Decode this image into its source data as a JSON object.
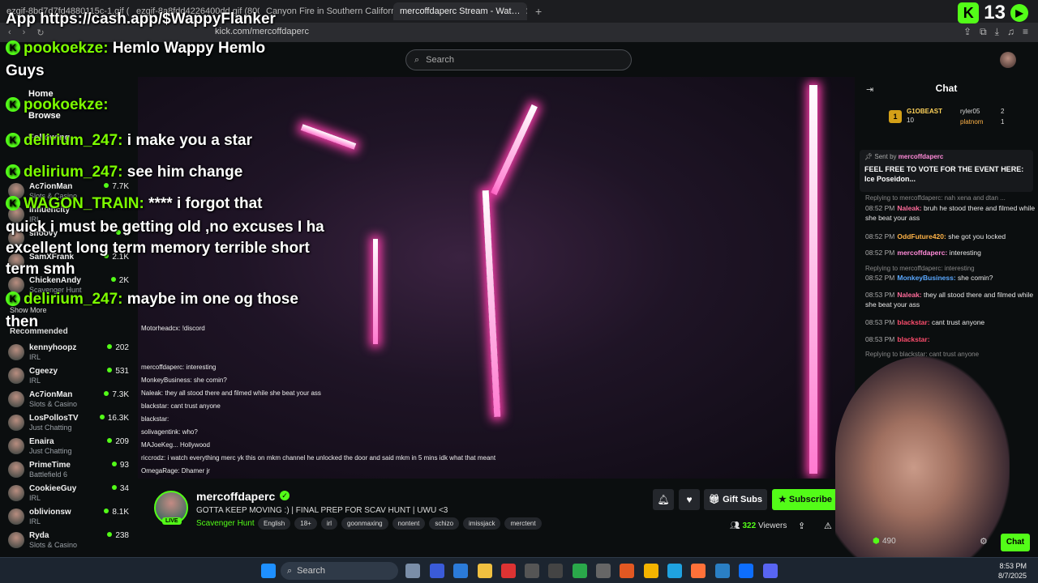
{
  "browser": {
    "tabs": [
      {
        "label": "ezgif-8bd7d7fd4880115c-1.gif (800×4…"
      },
      {
        "label": "ezgif-8a8fdd4226400dd.gif (800×4…"
      },
      {
        "label": "Canyon Fire in Southern California - …"
      },
      {
        "label": "mercoffdaperc Stream - Wat…"
      }
    ],
    "url": "kick.com/mercoffdaperc"
  },
  "search": {
    "placeholder": "Search"
  },
  "stream_overlay": {
    "line1": "App https://cash.app/$WappyFlanker",
    "messages": [
      {
        "user": "pookoekze:",
        "text": "Hemlo Wappy Hemlo"
      },
      {
        "text": "Guys"
      },
      {
        "user": "pookoekze:",
        "text": ""
      },
      {
        "user": "delirium_247:",
        "text": "i make you a star"
      },
      {
        "user": "delirium_247:",
        "text": "see him change"
      },
      {
        "user": "WAGON_TRAIN:",
        "text": "**** i forgot that"
      },
      {
        "text": "quick i must be getting old ,no excuses I ha"
      },
      {
        "text": "excellent long term memory terrible short"
      },
      {
        "text": "term smh"
      },
      {
        "user": "delirium_247:",
        "text": "maybe im one og those"
      },
      {
        "text": "then"
      }
    ],
    "score": "13"
  },
  "sidebar": {
    "nav": [
      {
        "label": "Home"
      },
      {
        "label": "Browse"
      },
      {
        "label": "Following"
      }
    ],
    "following": [
      {
        "name": "Ac7ionMan",
        "category": "Slots & Casino",
        "viewers": "7.7K"
      },
      {
        "name": "Influencity",
        "category": "IRL",
        "viewers": ""
      },
      {
        "name": "snoovy",
        "category": "",
        "viewers": "2"
      },
      {
        "name": "SamXFrank",
        "category": "",
        "viewers": "2.1K"
      },
      {
        "name": "ChickenAndy",
        "category": "Scavenger Hunt",
        "viewers": "2K"
      }
    ],
    "show_more": "Show More",
    "recommended_label": "Recommended",
    "recommended": [
      {
        "name": "kennyhoopz",
        "category": "IRL",
        "viewers": "202"
      },
      {
        "name": "Cgeezy",
        "category": "IRL",
        "viewers": "531"
      },
      {
        "name": "Ac7ionMan",
        "category": "Slots & Casino",
        "viewers": "7.3K"
      },
      {
        "name": "LosPollosTV",
        "category": "Just Chatting",
        "viewers": "16.3K"
      },
      {
        "name": "Enaira",
        "category": "Just Chatting",
        "viewers": "209"
      },
      {
        "name": "PrimeTime",
        "category": "Battlefield 6",
        "viewers": "93"
      },
      {
        "name": "CookieeGuy",
        "category": "IRL",
        "viewers": "34"
      },
      {
        "name": "oblivionsw",
        "category": "IRL",
        "viewers": "8.1K"
      },
      {
        "name": "Ryda",
        "category": "Slots & Casino",
        "viewers": "238"
      }
    ]
  },
  "video_chat": {
    "top": "Motorheadcx: !discord",
    "lines": [
      "mercoffdaperc: interesting",
      "MonkeyBusiness: she comin?",
      "Naleak: they all stood there and filmed while she beat your ass",
      "blackstar: cant trust anyone",
      "blackstar:",
      "solivagentink: who?",
      "MAJoeKeg... Hollywood",
      "riccrodz: i watch everything merc yk this on mkm channel he unlocked the door and said mkm in 5 mins idk what that meant",
      "OmegaRage: Dhamer jr"
    ]
  },
  "channel": {
    "name": "mercoffdaperc",
    "live": "LIVE",
    "title": "GOTTA KEEP MOVING :) | FINAL PREP FOR SCAV HUNT | UWU <3",
    "category": "Scavenger Hunt",
    "tags": [
      "English",
      "18+",
      "irl",
      "goonmaxing",
      "nontent",
      "schizo",
      "imissjack",
      "merctent"
    ],
    "gift_label": "Gift Subs",
    "subscribe_label": "Subscribe",
    "viewers": "322",
    "viewers_label": "Viewers"
  },
  "chat": {
    "title": "Chat",
    "leaderboard": [
      {
        "name": "G1OBEAST",
        "value": "10"
      },
      {
        "name": "ryler05",
        "value": "2"
      },
      {
        "name": "platnom",
        "value": "1"
      }
    ],
    "pinned": {
      "sender_prefix": "Sent by",
      "sender": "mercoffdaperc",
      "message": "FEEL FREE TO VOTE FOR THE EVENT HERE: Ice Poseidon..."
    },
    "messages": [
      {
        "reply": "Replying to mercoffdaperc: nah xena and dtan ..."
      },
      {
        "time": "08:52 PM",
        "user": "Naleak:",
        "color": "#ff6b9a",
        "text": "bruh he stood there and filmed while she beat your ass"
      },
      {
        "time": "08:52 PM",
        "user": "OddFuture420:",
        "color": "#ffb347",
        "text": "she got you locked"
      },
      {
        "time": "08:52 PM",
        "user": "mercoffdaperc:",
        "color": "#ff8ad8",
        "text": "interesting"
      },
      {
        "reply": "Replying to mercoffdaperc: interesting"
      },
      {
        "time": "08:52 PM",
        "user": "MonkeyBusiness:",
        "color": "#5aa8ff",
        "text": "she comin?"
      },
      {
        "time": "08:53 PM",
        "user": "Naleak:",
        "color": "#ff6b9a",
        "text": "they all stood there and filmed while she beat your ass"
      },
      {
        "time": "08:53 PM",
        "user": "blackstar:",
        "color": "#ff4d6d",
        "text": "cant trust anyone"
      },
      {
        "time": "08:53 PM",
        "user": "blackstar:",
        "color": "#ff4d6d",
        "text": ""
      },
      {
        "reply": "Replying to blackstar: cant trust anyone"
      }
    ],
    "send_label": "Chat",
    "points": "490"
  },
  "taskbar": {
    "search": "Search",
    "time": "8:53 PM",
    "date": "8/7/2025"
  },
  "colors": {
    "accent": "#53fc18",
    "background": "#0b0e0f"
  }
}
